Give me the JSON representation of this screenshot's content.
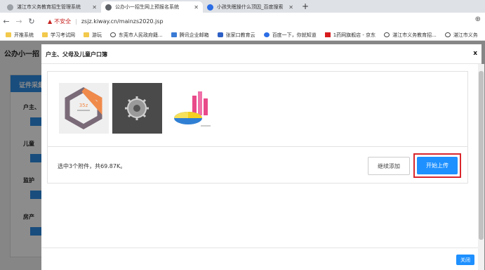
{
  "tabs": [
    {
      "title": "湛江市义务教育招生管理系统",
      "fav_color": "#9aa0a6",
      "active": false
    },
    {
      "title": "公办小一招生网上预报名系统",
      "fav_color": "#5f6368",
      "active": true
    },
    {
      "title": "小孩失眠操什么顶因_百度搜索",
      "fav_color": "#2b6de5",
      "active": false
    }
  ],
  "address": {
    "warning": "不安全",
    "url": "zsjz.kiway.cn/mainzs2020.jsp"
  },
  "bookmarks": [
    {
      "label": "开推系统",
      "icon": "folder"
    },
    {
      "label": "学习考试网",
      "icon": "folder"
    },
    {
      "label": "游玩",
      "icon": "folder"
    },
    {
      "label": "东莞市人民政府籍...",
      "icon": "globe"
    },
    {
      "label": "腾讯企业邮箱",
      "icon": "mail"
    },
    {
      "label": "张家口教育云",
      "icon": "cloud"
    },
    {
      "label": "百度一下，你就知道",
      "icon": "paw"
    },
    {
      "label": "1药网旗舰店 - 京东",
      "icon": "jd"
    },
    {
      "label": "湛江市义务教育招...",
      "icon": "globe"
    },
    {
      "label": "湛江市义务",
      "icon": "globe"
    }
  ],
  "page": {
    "title": "公办小一招",
    "card_title": "证件采集",
    "items": [
      "户主、",
      "儿童",
      "监护",
      "房产"
    ]
  },
  "modal": {
    "title": "户主、父母及儿童户口簿",
    "close": "x",
    "status": "选中3个附件，共69.87K。",
    "continue_label": "继续添加",
    "start_label": "开始上传",
    "close_button": "关闭"
  },
  "thumbnails": [
    {
      "name": "thumb-hexagon-logo",
      "badge": "35z"
    },
    {
      "name": "thumb-settings-gear"
    },
    {
      "name": "thumb-3d-chart"
    }
  ],
  "colors": {
    "accent": "#1e90ff",
    "highlight_border": "#d9262c",
    "card_header": "#2f8de4"
  }
}
